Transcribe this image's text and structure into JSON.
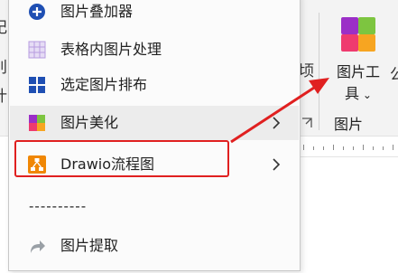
{
  "menu": {
    "items": [
      {
        "label": "图片叠加器",
        "icon": "plus-circle-icon"
      },
      {
        "label": "表格内图片处理",
        "icon": "table-grid-icon"
      },
      {
        "label": "选定图片排布",
        "icon": "layout-grid-icon"
      },
      {
        "label": "图片美化",
        "icon": "color-blocks-icon"
      },
      {
        "label": "Drawio流程图",
        "icon": "drawio-icon"
      },
      {
        "label": "图片提取",
        "icon": "share-arrow-icon"
      }
    ],
    "separator_text": "----------"
  },
  "ribbon": {
    "tool_label_line1": "图片工",
    "tool_label_line2": "具",
    "group_label": "图片",
    "edge_glyphs": [
      "纪",
      "别",
      "计",
      "顷",
      "公"
    ]
  },
  "colors": {
    "highlight": "#e02020",
    "arrow": "#e02020",
    "accent_blue": "#1f4fb3"
  }
}
